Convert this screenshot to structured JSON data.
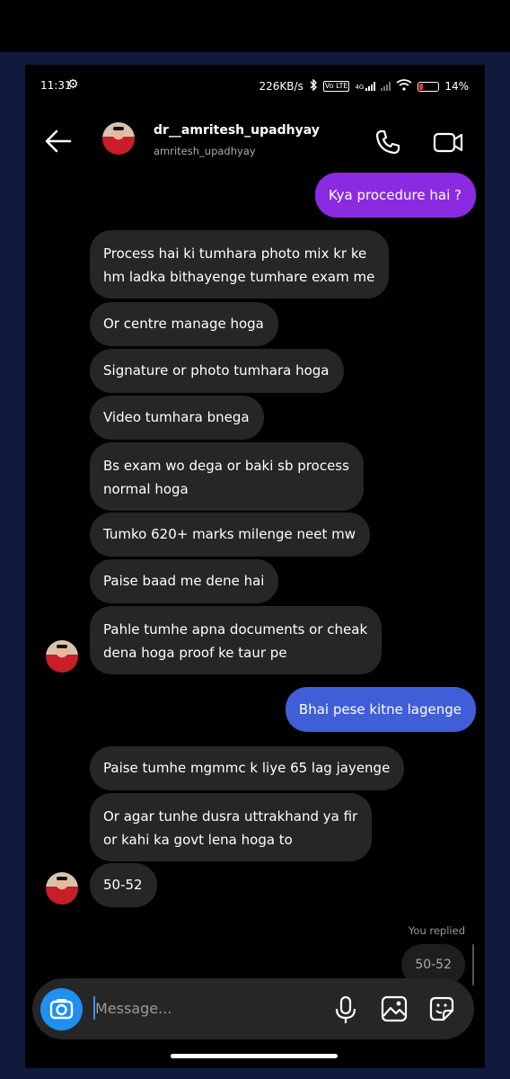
{
  "status_bar": {
    "time": "11:31",
    "net_speed": "226KB/s",
    "volte_label": "Vo LTE",
    "network_label": "4G",
    "battery": "14%"
  },
  "header": {
    "display_name": "dr__amritesh_upadhyay",
    "username": "amritesh_upadhyay",
    "icons": [
      "back-arrow-icon",
      "phone-call-icon",
      "video-call-icon"
    ]
  },
  "messages": [
    {
      "from": "me",
      "lines": [
        "Kya procedure hai ?"
      ],
      "color": "#8a2be2"
    },
    {
      "from": "them",
      "lines": [
        "Process hai ki tumhara photo mix kr ke",
        "hm ladka bithayenge tumhare exam me"
      ]
    },
    {
      "from": "them",
      "lines": [
        "Or centre manage hoga"
      ]
    },
    {
      "from": "them",
      "lines": [
        "Signature or photo tumhara hoga"
      ]
    },
    {
      "from": "them",
      "lines": [
        "Video tumhara bnega"
      ]
    },
    {
      "from": "them",
      "lines": [
        "Bs exam wo dega or baki sb process",
        "normal hoga"
      ]
    },
    {
      "from": "them",
      "lines": [
        "Tumko 620+ marks milenge neet mw"
      ]
    },
    {
      "from": "them",
      "lines": [
        "Paise baad me dene hai"
      ]
    },
    {
      "from": "them",
      "lines": [
        "Pahle tumhe apna documents or cheak",
        "dena hoga proof ke taur pe"
      ]
    },
    {
      "from": "me",
      "lines": [
        "Bhai pese kitne lagenge"
      ],
      "color": "#3f5ed8"
    },
    {
      "from": "them",
      "lines": [
        "Paise tumhe mgmmc k liye 65 lag jayenge"
      ]
    },
    {
      "from": "them",
      "lines": [
        "Or agar tunhe dusra uttrakhand ya fir",
        "or kahi ka govt lena hoga to"
      ]
    },
    {
      "from": "them",
      "lines": [
        "50-52"
      ]
    }
  ],
  "you_replied_label": "You replied",
  "quoted_reply": "50-52",
  "composer": {
    "placeholder": "Message...",
    "icons": [
      "camera-icon",
      "microphone-icon",
      "gallery-icon",
      "sticker-icon"
    ]
  },
  "colors": {
    "incoming_bubble": "#262626",
    "camera_button": "#1f8ff0",
    "background": "#000000"
  }
}
